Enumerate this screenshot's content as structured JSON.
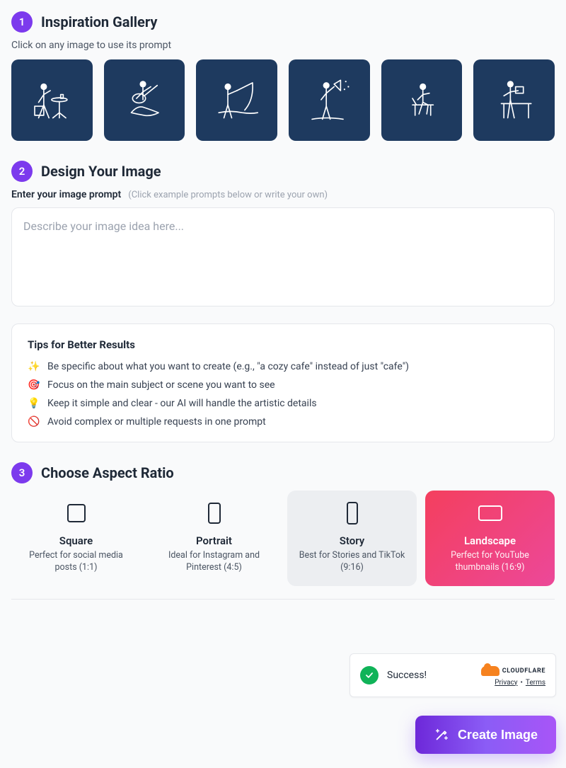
{
  "step1": {
    "number": "1",
    "title": "Inspiration Gallery",
    "subhead": "Click on any image to use its prompt",
    "gallery": [
      {
        "name": "coffee-table"
      },
      {
        "name": "guitar-on-rock"
      },
      {
        "name": "fishing"
      },
      {
        "name": "megaphone"
      },
      {
        "name": "bench-sitting"
      },
      {
        "name": "reading-desk"
      }
    ]
  },
  "step2": {
    "number": "2",
    "title": "Design Your Image",
    "prompt_label": "Enter your image prompt",
    "prompt_hint": "(Click example prompts below or write your own)",
    "placeholder": "Describe your image idea here...",
    "value": ""
  },
  "tips": {
    "title": "Tips for Better Results",
    "items": [
      {
        "emoji": "✨",
        "text": "Be specific about what you want to create (e.g., \"a cozy cafe\" instead of just \"cafe\")"
      },
      {
        "emoji": "🎯",
        "text": "Focus on the main subject or scene you want to see"
      },
      {
        "emoji": "💡",
        "text": "Keep it simple and clear - our AI will handle the artistic details"
      },
      {
        "emoji": "🚫",
        "text": "Avoid complex or multiple requests in one prompt"
      }
    ]
  },
  "step3": {
    "number": "3",
    "title": "Choose Aspect Ratio",
    "options": [
      {
        "key": "square",
        "name": "Square",
        "desc": "Perfect for social media posts (1:1)"
      },
      {
        "key": "portrait",
        "name": "Portrait",
        "desc": "Ideal for Instagram and Pinterest (4:5)"
      },
      {
        "key": "story",
        "name": "Story",
        "desc": "Best for Stories and TikTok (9:16)"
      },
      {
        "key": "landscape",
        "name": "Landscape",
        "desc": "Perfect for YouTube thumbnails (16:9)"
      }
    ],
    "hovered": "story",
    "selected": "landscape"
  },
  "cloudflare": {
    "status": "Success!",
    "brand": "CLOUDFLARE",
    "privacy": "Privacy",
    "terms": "Terms"
  },
  "create_button": "Create Image"
}
